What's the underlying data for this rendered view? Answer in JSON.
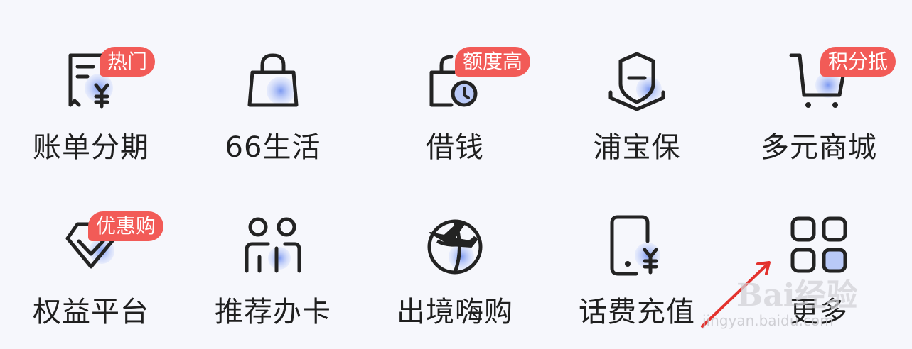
{
  "menu": {
    "items": [
      {
        "label": "账单分期",
        "badge": "热门",
        "icon": "bill-yen-icon"
      },
      {
        "label": "66生活",
        "badge": "",
        "icon": "shopping-bag-icon"
      },
      {
        "label": "借钱",
        "badge": "额度高",
        "icon": "bag-clock-icon"
      },
      {
        "label": "浦宝保",
        "badge": "",
        "icon": "shield-icon"
      },
      {
        "label": "多元商城",
        "badge": "积分抵",
        "icon": "cart-icon"
      },
      {
        "label": "权益平台",
        "badge": "优惠购",
        "icon": "diamond-check-icon"
      },
      {
        "label": "推荐办卡",
        "badge": "",
        "icon": "people-icon"
      },
      {
        "label": "出境嗨购",
        "badge": "",
        "icon": "globe-plane-icon"
      },
      {
        "label": "话费充值",
        "badge": "",
        "icon": "phone-yen-icon"
      },
      {
        "label": "更多",
        "badge": "",
        "icon": "grid-icon"
      }
    ]
  },
  "watermark": {
    "text": "Bai经验",
    "url": "jingyan.baidu.com"
  },
  "colors": {
    "badge": "#f25b57",
    "icon_stroke": "#232323",
    "icon_accent": "#a9bdf5",
    "background": "#f6f7fc"
  }
}
